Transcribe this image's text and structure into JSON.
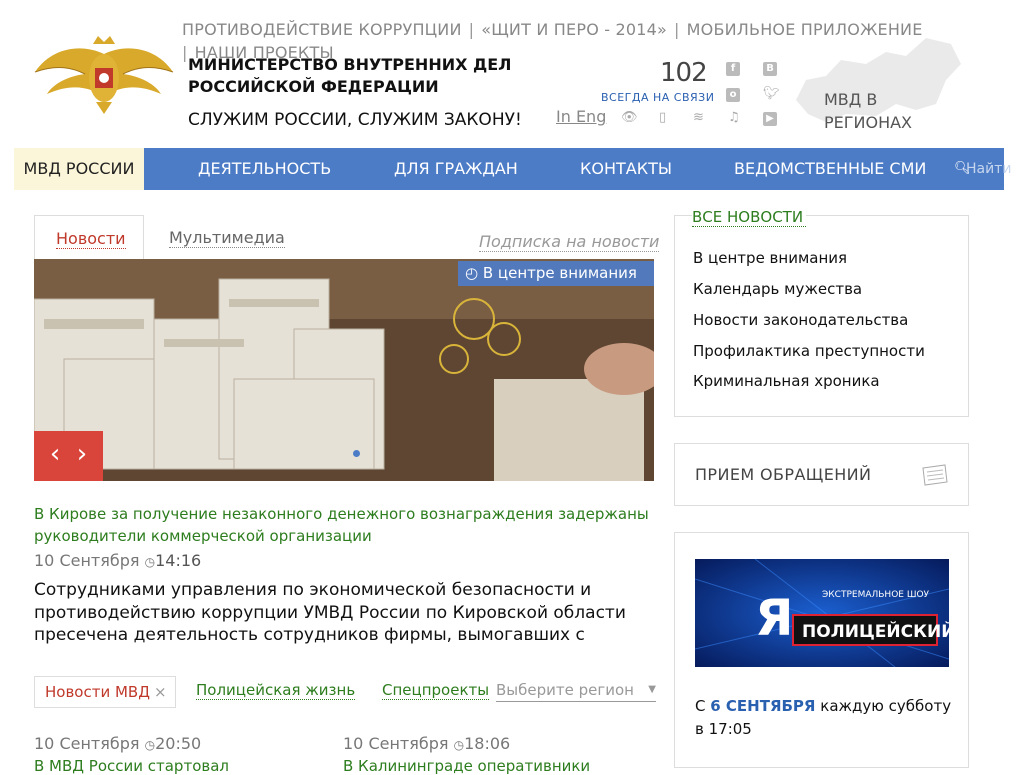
{
  "header": {
    "top_links": [
      "ПРОТИВОДЕЙСТВИЕ КОРРУПЦИИ",
      "«ЩИТ И ПЕРО - 2014»",
      "МОБИЛЬНОЕ ПРИЛОЖЕНИЕ",
      "НАШИ ПРОЕКТЫ"
    ],
    "ministry": "МИНИСТЕРСТВО ВНУТРЕННИХ ДЕЛ РОССИЙСКОЙ ФЕДЕРАЦИИ",
    "motto": "СЛУЖИМ РОССИИ, СЛУЖИМ ЗАКОНУ!",
    "hotline": "102",
    "hotline_caption": "ВСЕГДА НА СВЯЗИ",
    "lang": "In Eng",
    "regions_line1": "МВД В",
    "regions_line2": "РЕГИОНАХ",
    "social_icons": [
      "facebook-icon",
      "vk-icon",
      "odnoklassniki-icon",
      "twitter-icon",
      "livejournal-icon",
      "youtube-icon"
    ],
    "utility_icons": [
      "low-vision-icon",
      "mobile-icon",
      "rss-icon",
      "music-icon"
    ]
  },
  "nav": {
    "items": [
      "МВД РОССИИ",
      "ДЕЯТЕЛЬНОСТЬ",
      "ДЛЯ ГРАЖДАН",
      "КОНТАКТЫ",
      "ВЕДОМСТВЕННЫЕ СМИ"
    ],
    "search_label": "Найти",
    "color": "#4d7cc7"
  },
  "main": {
    "tabs": [
      "Новости",
      "Мультимедиа"
    ],
    "subscribe": "Подписка на новости",
    "badge": "В центре внимания",
    "headline": "В Кирове за получение незаконного денежного вознаграждения задержаны руководители коммерческой организации",
    "date": "10 Сентября",
    "time": "14:16",
    "lead": "Сотрудниками управления по экономической безопасности и противодействию коррупции УМВД России по Кировской области пресечена деятельность сотрудников фирмы, вымогавших с",
    "filters": [
      "Новости МВД",
      "Полицейская жизнь",
      "Спецпроекты"
    ],
    "region_select": "Выберите регион",
    "news": [
      {
        "date": "10 Сентября",
        "time": "20:50",
        "title": "В МВД России стартовал"
      },
      {
        "date": "10 Сентября",
        "time": "18:06",
        "title": "В Калининграде оперативники"
      }
    ]
  },
  "sidebar": {
    "all_news": "ВСЕ НОВОСТИ",
    "links": [
      "В центре внимания",
      "Календарь мужества",
      "Новости законодательства",
      "Профилактика преступности",
      "Криминальная хроника"
    ],
    "appeal": "ПРИЕМ ОБРАЩЕНИЙ",
    "promo_small": "ЭКСТРЕМАЛЬНОЕ ШОУ",
    "promo_big_letter": "Я",
    "promo_title": "ПОЛИЦЕЙСКИЙ",
    "promo_pre": "С ",
    "promo_date": "6 СЕНТЯБРЯ",
    "promo_post": " каждую субботу в 17:05"
  }
}
